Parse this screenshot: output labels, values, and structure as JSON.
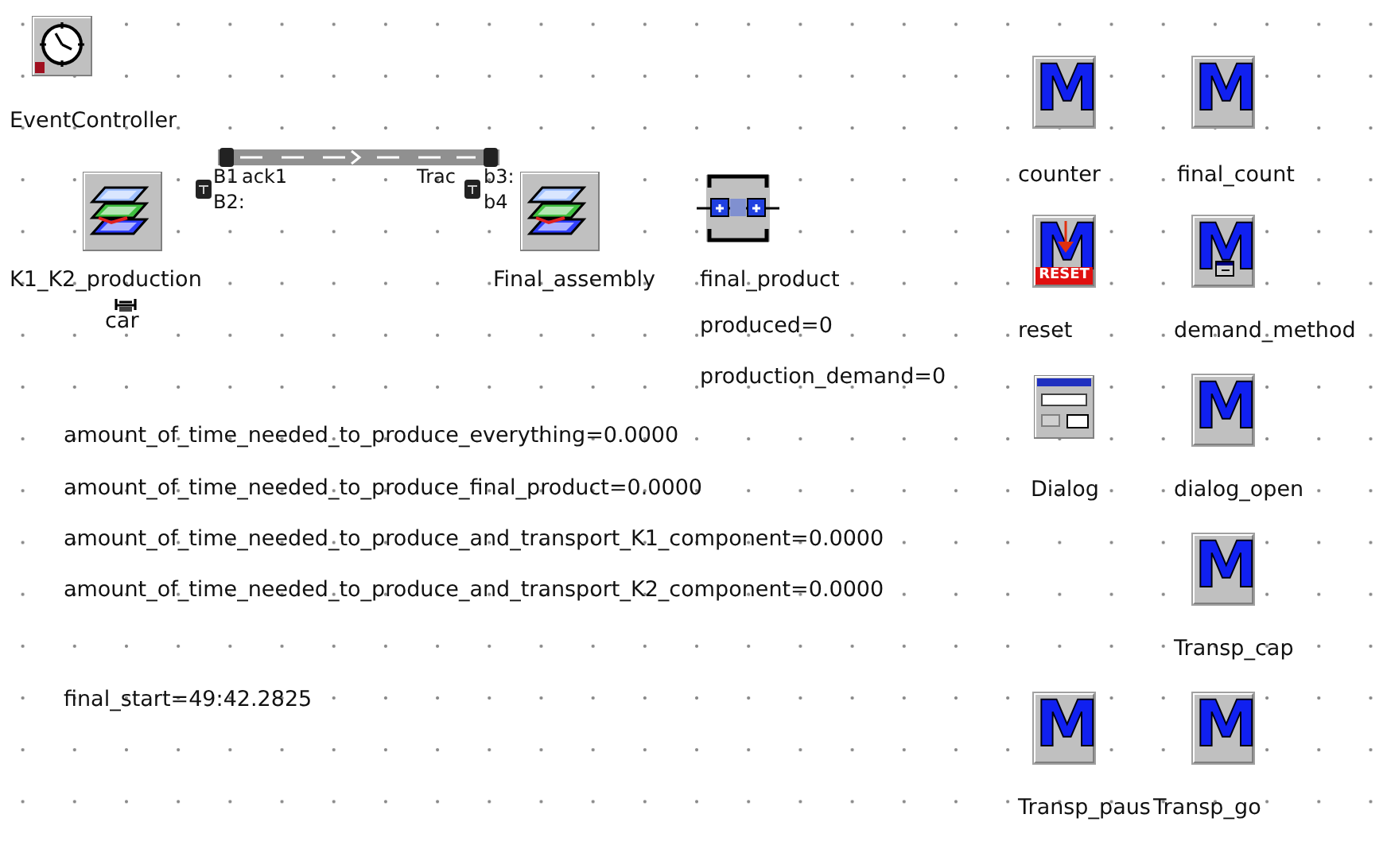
{
  "objects": [
    {
      "kind": "event_controller",
      "label": "EventController"
    },
    {
      "kind": "frame",
      "label": "K1_K2_production"
    },
    {
      "kind": "frame",
      "label": "Final_assembly"
    },
    {
      "kind": "station",
      "label": "final_product"
    },
    {
      "kind": "method",
      "glyph": "M",
      "label": "counter"
    },
    {
      "kind": "method",
      "glyph": "M",
      "label": "final_count"
    },
    {
      "kind": "method_reset",
      "glyph": "M",
      "badge": "RESET",
      "label": "reset"
    },
    {
      "kind": "method_dialog",
      "glyph": "M",
      "label": "demand_method"
    },
    {
      "kind": "dialog",
      "label": "Dialog"
    },
    {
      "kind": "method",
      "glyph": "M",
      "label": "dialog_open"
    },
    {
      "kind": "method",
      "glyph": "M",
      "label": "Transp_cap"
    },
    {
      "kind": "method",
      "glyph": "M",
      "label": "Transp_paus"
    },
    {
      "kind": "method",
      "glyph": "M",
      "label": "Transp_go"
    },
    {
      "kind": "entity",
      "label": "car"
    }
  ],
  "track": {
    "labels": [
      "B1",
      "ack1",
      "Trac",
      "b3:",
      "B2:",
      "b4"
    ]
  },
  "variables": [
    "produced=0",
    "production_demand=0",
    "amount_of_time_needed_to_produce_everything=0.0000",
    "amount_of_time_needed_to_produce_final_product=0.0000",
    "amount_of_time_needed_to_produce_and_transport_K1_component=0.0000",
    "amount_of_time_needed_to_produce_and_transport_K2_component=0.0000",
    "final_start=49:42.2825"
  ]
}
